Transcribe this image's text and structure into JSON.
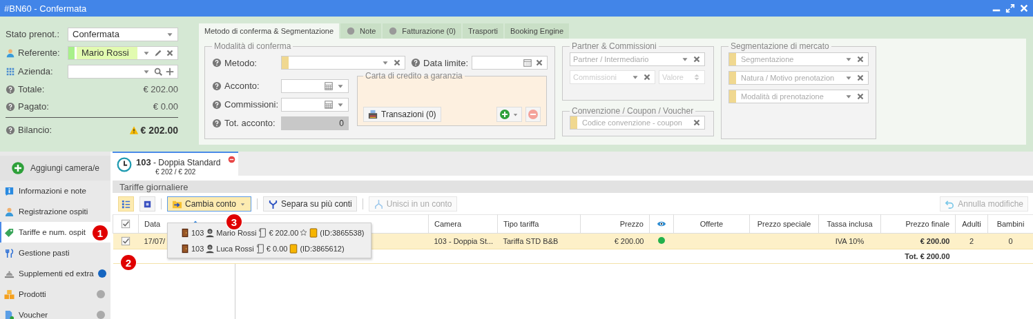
{
  "window": {
    "title": "#BN60 - Confermata"
  },
  "booking": {
    "fields": [
      {
        "kind": "select",
        "label": "Stato prenot.:",
        "value": "Confermata"
      },
      {
        "kind": "person",
        "label": "Referente:",
        "value": "Mario Rossi"
      },
      {
        "kind": "company",
        "label": "Azienda:"
      }
    ],
    "totals": [
      {
        "label": "Totale:",
        "value": "€ 202.00"
      },
      {
        "label": "Pagato:",
        "value": "€ 0.00"
      }
    ],
    "balance": {
      "label": "Bilancio:",
      "value": "€ 202.00",
      "warning": true
    }
  },
  "tabs": [
    {
      "label": "Metodo di conferma & Segmentazione",
      "selected": true,
      "indicator": false
    },
    {
      "label": "Note",
      "selected": false,
      "indicator": true
    },
    {
      "label": "Fatturazione (0)",
      "selected": false,
      "indicator": true
    },
    {
      "label": "Trasporti",
      "selected": false,
      "indicator": false
    },
    {
      "label": "Booking Engine",
      "selected": false,
      "indicator": false
    }
  ],
  "conferma": {
    "legend": "Modalità di conferma",
    "metodo": "Metodo:",
    "data_limite": "Data limite:",
    "acconto": "Acconto:",
    "commissioni": "Commissioni:",
    "tot_acconto": {
      "label": "Tot. acconto:",
      "value": "0"
    },
    "carta": {
      "legend": "Carta di credito a garanzia",
      "button": "Transazioni (0)"
    }
  },
  "partner": {
    "legend": "Partner & Commissioni",
    "partner_placeholder": "Partner / Intermediario",
    "commissioni_placeholder": "Commissioni",
    "valore_placeholder": "Valore"
  },
  "convenzione": {
    "legend": "Convenzione / Coupon / Voucher",
    "placeholder": "Codice convenzione - coupon"
  },
  "segmentazione": {
    "legend": "Segmentazione di mercato",
    "fields": [
      {
        "placeholder": "Segmentazione"
      },
      {
        "placeholder": "Natura / Motivo prenotazion"
      },
      {
        "placeholder": "Modalità di prenotazione"
      }
    ]
  },
  "sidebar": {
    "add_button": "Aggiungi camera/e",
    "items": [
      {
        "label": "Informazioni e note",
        "selected": false
      },
      {
        "label": "Registrazione ospiti",
        "selected": false
      },
      {
        "label": "Tariffe e num. ospit",
        "selected": true
      },
      {
        "label": "Gestione pasti",
        "selected": false
      },
      {
        "label": "Supplementi ed extra",
        "selected": false,
        "color": "#1565c0"
      },
      {
        "label": "Prodotti",
        "selected": false,
        "color": "#aaaaaa"
      },
      {
        "label": "Voucher",
        "selected": false,
        "color": "#aaaaaa"
      }
    ]
  },
  "room_tab": {
    "number": "103",
    "name": "- Doppia Standard",
    "amount": "€ 202 / € 202"
  },
  "section_title": "Tariffe giornaliere",
  "toolbar": {
    "buttons": [
      {
        "kind": "list",
        "selected": true
      },
      {
        "kind": "square",
        "selected": false
      },
      {
        "kind": "change",
        "label": "Cambia conto",
        "selected": true
      },
      {
        "kind": "split",
        "label": "Separa su più conti",
        "disabled": false
      },
      {
        "kind": "merge",
        "label": "Unisci in un conto",
        "disabled": true
      }
    ],
    "undo": {
      "label": "Annulla modifiche",
      "disabled": true
    }
  },
  "account_menu": [
    {
      "room": "103",
      "guest": "Mario Rossi",
      "amount": "€ 202.00",
      "starred": true,
      "id": "(ID:3865538)"
    },
    {
      "room": "103",
      "guest": "Luca Rossi",
      "amount": "€ 0.00",
      "starred": false,
      "id": "(ID:3865612)"
    }
  ],
  "table": {
    "all_checked": true,
    "columns": [
      {
        "kind": "check"
      },
      {
        "kind": "sort",
        "label": "Data"
      },
      {
        "kind": "blank"
      },
      {
        "kind": "text",
        "label": "Camera"
      },
      {
        "kind": "text",
        "label": "Tipo tariffa"
      },
      {
        "kind": "text",
        "label": "Prezzo"
      },
      {
        "kind": "eye"
      },
      {
        "kind": "text",
        "label": "Offerte"
      },
      {
        "kind": "text",
        "label": "Prezzo speciale"
      },
      {
        "kind": "text",
        "label": "Tassa inclusa"
      },
      {
        "kind": "text",
        "label": "Prezzo finale"
      },
      {
        "kind": "text",
        "label": "Adulti"
      },
      {
        "kind": "text",
        "label": "Bambini"
      }
    ],
    "rows": [
      {
        "selected": true,
        "checked": true,
        "date": "17/07/",
        "camera": "103 - Doppia St...",
        "tipo": "Tariffa STD B&B",
        "prezzo": "€ 200.00",
        "color": "#22b14c",
        "tassa": "IVA 10%",
        "prezzo_finale": "€ 200.00",
        "adulti": "2",
        "bambini": "0"
      }
    ],
    "total": "Tot. € 200.00"
  },
  "annotations": [
    "1",
    "2",
    "3"
  ]
}
